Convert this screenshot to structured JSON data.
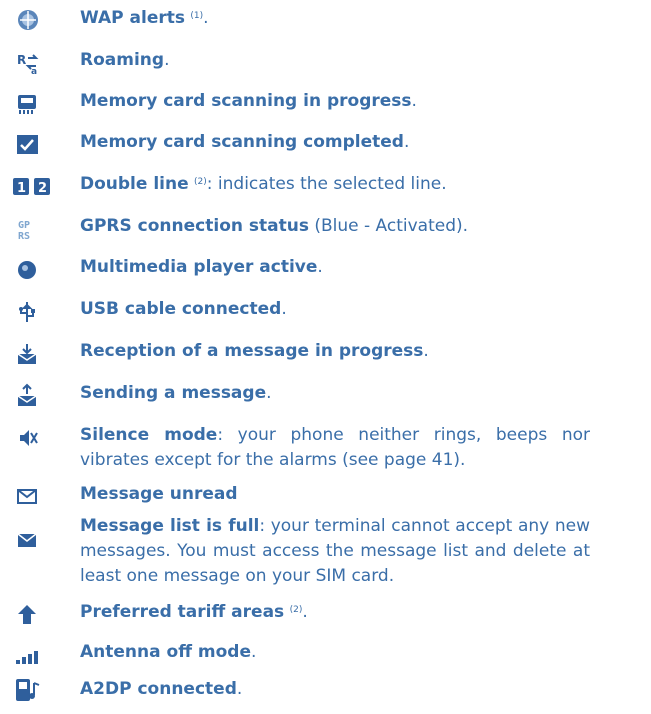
{
  "items": [
    {
      "icon": "wap-alert-icon",
      "bold": "WAP alerts",
      "sup": "(1)",
      "rest": "."
    },
    {
      "icon": "roaming-icon",
      "bold": "Roaming",
      "rest": "."
    },
    {
      "icon": "memory-card-scanning-icon",
      "bold": "Memory card scanning in progress",
      "rest": "."
    },
    {
      "icon": "memory-card-completed-icon",
      "bold": "Memory card scanning completed",
      "rest": "."
    },
    {
      "icon": "double-line-icon",
      "bold": "Double line",
      "sup": "(2)",
      "rest": ": indicates the selected line."
    },
    {
      "icon": "gprs-icon",
      "bold": "GPRS connection status",
      "rest": " (Blue - Activated)."
    },
    {
      "icon": "multimedia-player-icon",
      "bold": "Multimedia player active",
      "rest": "."
    },
    {
      "icon": "usb-icon",
      "bold": "USB cable connected",
      "rest": "."
    },
    {
      "icon": "message-reception-icon",
      "bold": "Reception of a message in progress",
      "rest": "."
    },
    {
      "icon": "message-sending-icon",
      "bold": "Sending a message",
      "rest": "."
    },
    {
      "icon": "silence-mode-icon",
      "bold": "Silence mode",
      "rest": ": your phone neither rings, beeps nor vibrates except for the alarms (see page 41)."
    },
    {
      "icon": "message-unread-icon",
      "bold": "Message unread",
      "rest": ""
    },
    {
      "icon": "message-list-full-icon",
      "bold": "Message list is full",
      "rest": ": your terminal cannot accept any new messages. You must access the message list and delete at least one message on your SIM card."
    },
    {
      "icon": "preferred-tariff-icon",
      "bold": "Preferred tariff areas",
      "sup": "(2)",
      "rest": "."
    },
    {
      "icon": "antenna-off-icon",
      "bold": "Antenna off mode",
      "rest": "."
    },
    {
      "icon": "a2dp-icon",
      "bold": "A2DP connected",
      "rest": "."
    }
  ],
  "colors": {
    "text": "#3a6ea8",
    "icon_blue": "#2f5f9c",
    "icon_light": "#7fa6cf"
  }
}
